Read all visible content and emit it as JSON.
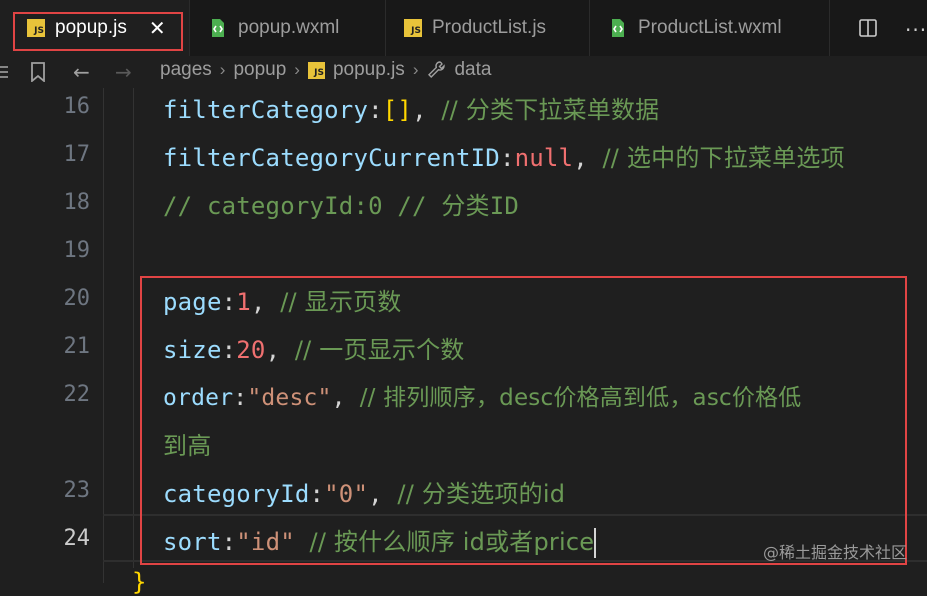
{
  "tabs": [
    {
      "label": "popup.js",
      "icon": "js-file-icon",
      "active": true
    },
    {
      "label": "popup.wxml",
      "icon": "wxml-file-icon",
      "active": false
    },
    {
      "label": "ProductList.js",
      "icon": "js-file-icon",
      "active": false
    },
    {
      "label": "ProductList.wxml",
      "icon": "wxml-file-icon",
      "active": false
    }
  ],
  "tab_close_glyph": "✕",
  "js_badge": "JS",
  "more_glyph": "···",
  "breadcrumb": {
    "items": [
      "pages",
      "popup",
      "popup.js",
      "data"
    ],
    "separator": "›"
  },
  "line_numbers": [
    "16",
    "17",
    "18",
    "19",
    "20",
    "21",
    "22",
    "",
    "23",
    "24"
  ],
  "active_line": "24",
  "code": {
    "l16": {
      "key": "filterCategory",
      "colon": ":",
      "open": "[",
      "close": "]",
      "comma": ",",
      "comment": "// 分类下拉菜单数据"
    },
    "l17": {
      "key": "filterCategoryCurrentID",
      "colon": ":",
      "value": "null",
      "comma": ",",
      "comment": "// 选中的下拉菜单选项"
    },
    "l18": {
      "comment": "// categoryId:0 // 分类ID"
    },
    "l20": {
      "key": "page",
      "colon": ":",
      "value": "1",
      "comma": ",",
      "comment": "// 显示页数"
    },
    "l21": {
      "key": "size",
      "colon": ":",
      "value": "20",
      "comma": ",",
      "comment": "// 一页显示个数"
    },
    "l22": {
      "key": "order",
      "colon": ":",
      "value": "\"desc\"",
      "comma": ",",
      "comment": "// 排列顺序，desc价格高到低，asc价格低"
    },
    "l22b": {
      "comment": "到高"
    },
    "l23": {
      "key": "categoryId",
      "colon": ":",
      "value": "\"0\"",
      "comma": ",",
      "comment": "// 分类选项的id"
    },
    "l24": {
      "key": "sort",
      "colon": ":",
      "value": "\"id\"",
      "comment": "// 按什么顺序 id或者price"
    }
  },
  "closing_brace": "}",
  "watermark": "@稀土掘金技术社区",
  "colors": {
    "highlight_border": "#e04444",
    "property": "#9cdcfe",
    "string": "#ce9178",
    "number": "#f07070",
    "comment": "#6a9955",
    "bracket": "#ffd700"
  }
}
